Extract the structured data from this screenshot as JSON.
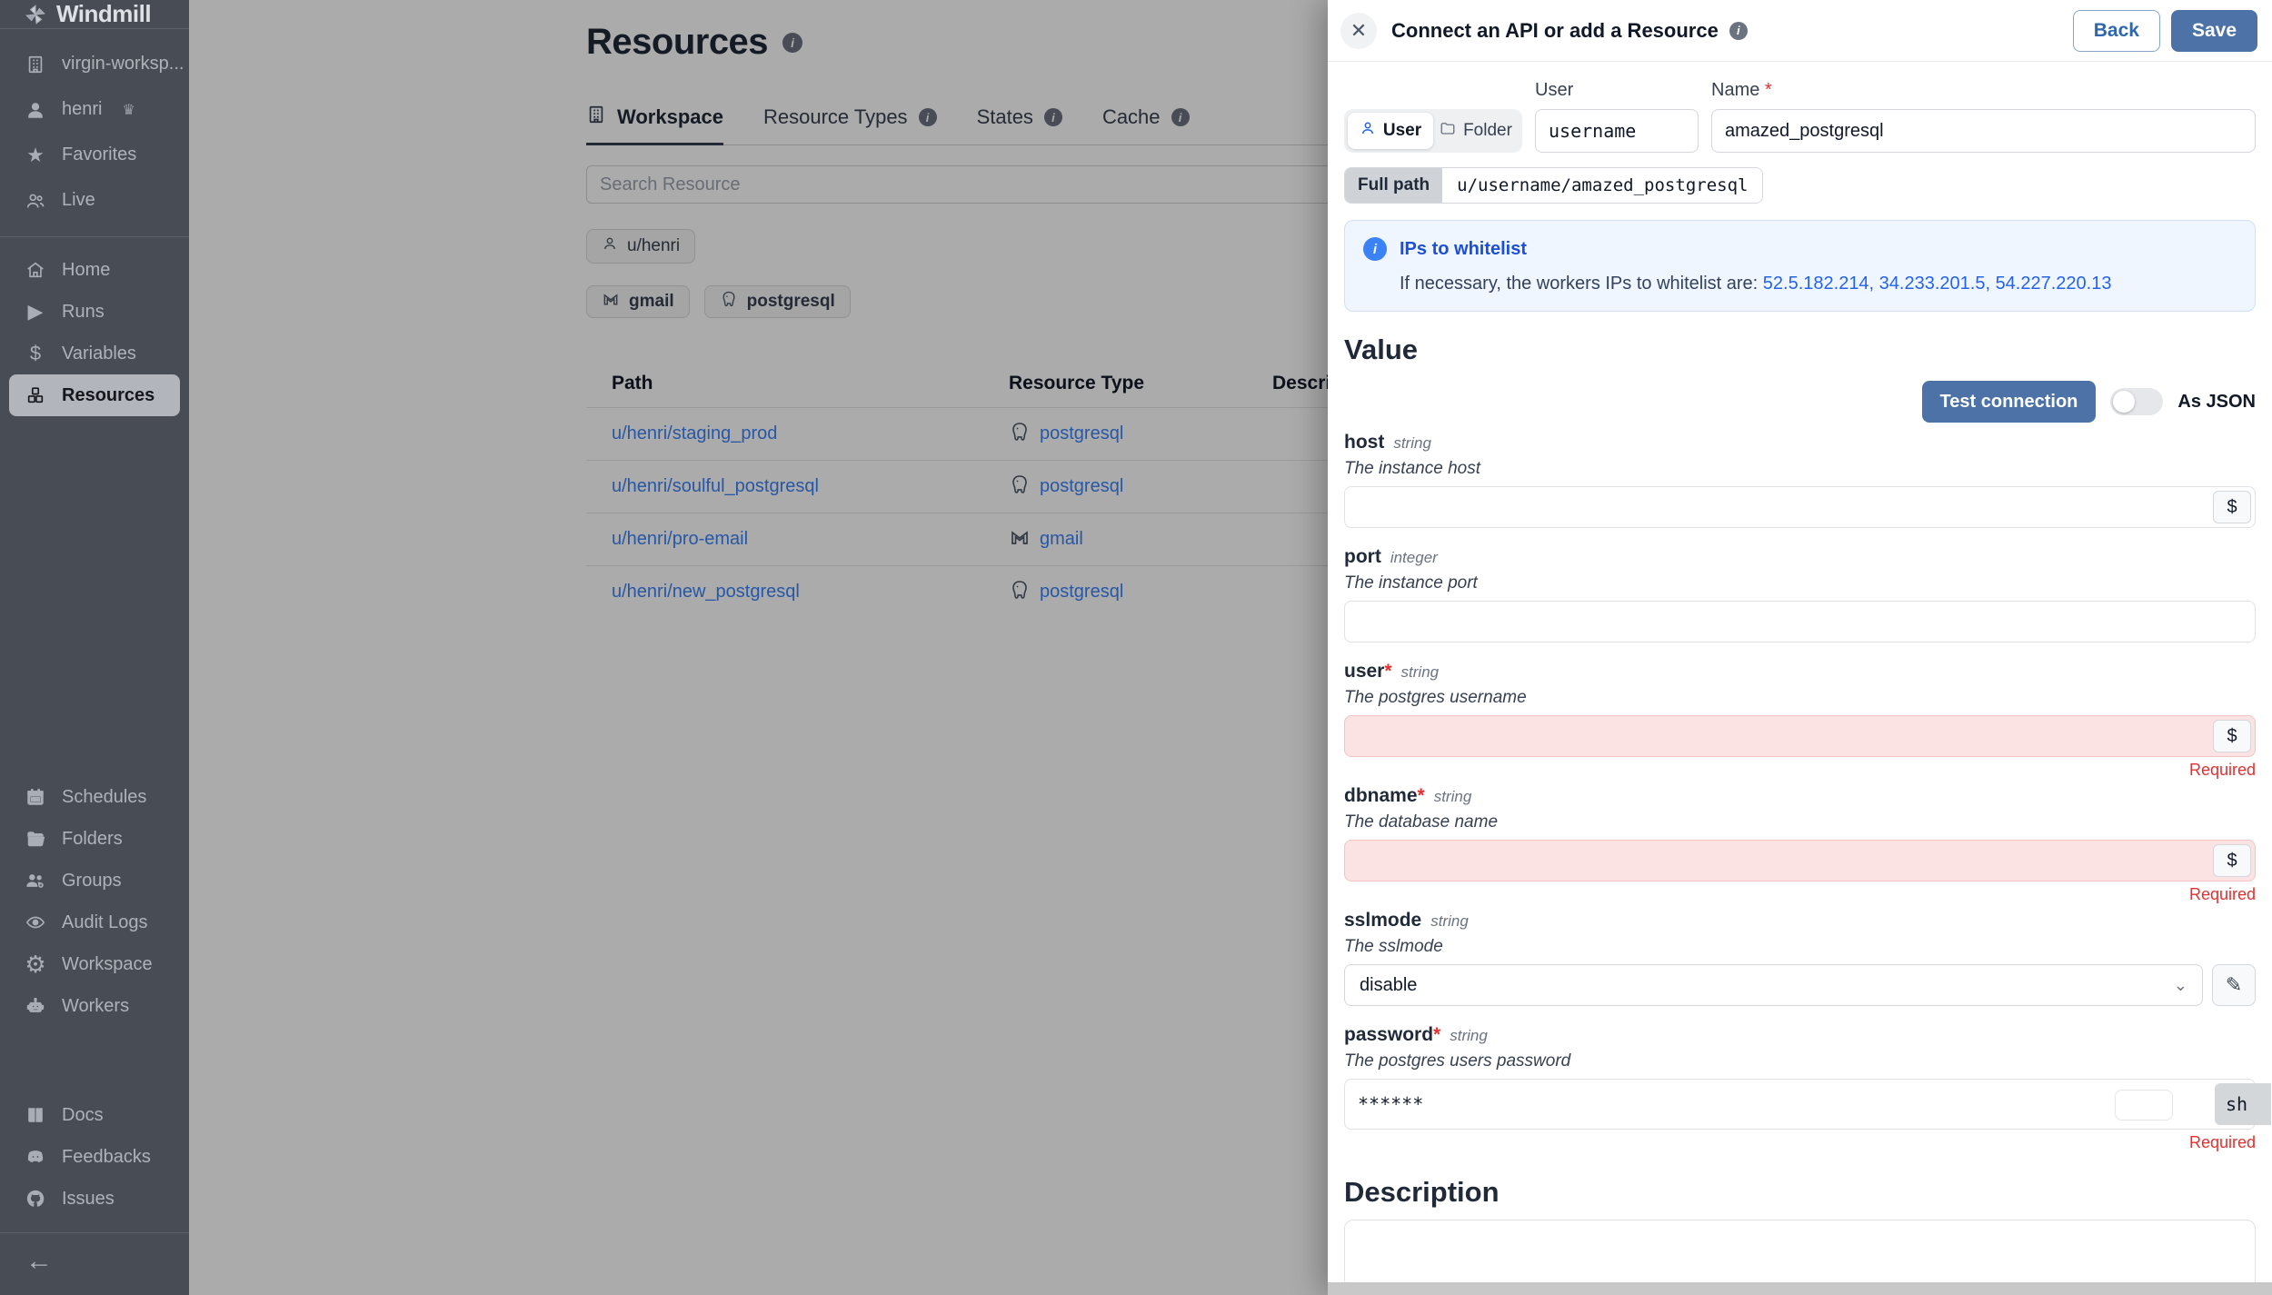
{
  "icons": {
    "dollar": "$",
    "gear": "⚙",
    "star": "★",
    "play": "▶",
    "home_glyph": "⌂",
    "close": "✕",
    "back_arrow": "←",
    "crown": "♛",
    "chevron_down": "⌄",
    "pencil": "✎",
    "info_i": "i",
    "asterisk": "*"
  },
  "colors": {
    "accent": "#4c72a8",
    "link": "#3b82f6",
    "error": "#e03131",
    "sidebar_bg": "#474c55",
    "info_bg": "#eff6ff",
    "info_title": "#1d4ed8"
  },
  "sidebar": {
    "logo_label": "Windmill",
    "account": [
      {
        "label": "virgin-worksp..."
      },
      {
        "label": "henri"
      },
      {
        "label": "Favorites"
      },
      {
        "label": "Live"
      }
    ],
    "nav": [
      {
        "label": "Home"
      },
      {
        "label": "Runs"
      },
      {
        "label": "Variables"
      },
      {
        "label": "Resources"
      }
    ],
    "admin": [
      {
        "label": "Schedules"
      },
      {
        "label": "Folders"
      },
      {
        "label": "Groups"
      },
      {
        "label": "Audit Logs"
      },
      {
        "label": "Workspace"
      },
      {
        "label": "Workers"
      }
    ],
    "help": [
      {
        "label": "Docs"
      },
      {
        "label": "Feedbacks"
      },
      {
        "label": "Issues"
      }
    ]
  },
  "main": {
    "title": "Resources",
    "tabs": [
      {
        "label": "Workspace"
      },
      {
        "label": "Resource Types"
      },
      {
        "label": "States"
      },
      {
        "label": "Cache"
      }
    ],
    "search_placeholder": "Search Resource",
    "owner_chip": "u/henri",
    "type_chips": [
      "gmail",
      "postgresql"
    ],
    "table": {
      "headers": [
        "Path",
        "Resource Type",
        "Description"
      ],
      "rows": [
        {
          "path": "u/henri/staging_prod",
          "type": "postgresql"
        },
        {
          "path": "u/henri/soulful_postgresql",
          "type": "postgresql"
        },
        {
          "path": "u/henri/pro-email",
          "type": "gmail"
        },
        {
          "path": "u/henri/new_postgresql",
          "type": "postgresql"
        }
      ]
    }
  },
  "drawer": {
    "title": "Connect an API or add a Resource",
    "back_label": "Back",
    "save_label": "Save",
    "owner_toggle": {
      "user": "User",
      "folder": "Folder"
    },
    "user_label": "User",
    "user_value": "username",
    "name_label": "Name",
    "name_value": "amazed_postgresql",
    "full_path_label": "Full path",
    "full_path_value": "u/username/amazed_postgresql",
    "infobox": {
      "title": "IPs to whitelist",
      "text": "If necessary, the workers IPs to whitelist are:",
      "ips": "52.5.182.214, 34.233.201.5, 54.227.220.13"
    },
    "value_heading": "Value",
    "test_connection_label": "Test connection",
    "as_json_label": "As JSON",
    "fields": [
      {
        "name": "host",
        "type": "string",
        "desc": "The instance host",
        "value": ""
      },
      {
        "name": "port",
        "type": "integer",
        "desc": "The instance port",
        "value": ""
      },
      {
        "name": "user",
        "type": "string",
        "desc": "The postgres username",
        "value": "",
        "error": "Required"
      },
      {
        "name": "dbname",
        "type": "string",
        "desc": "The database name",
        "value": "",
        "error": "Required"
      },
      {
        "name": "sslmode",
        "type": "string",
        "desc": "The sslmode",
        "value": "disable"
      },
      {
        "name": "password",
        "type": "string",
        "desc": "The postgres users password",
        "value": "******",
        "error": "Required",
        "show_chip": "sh"
      }
    ],
    "description_heading": "Description"
  }
}
